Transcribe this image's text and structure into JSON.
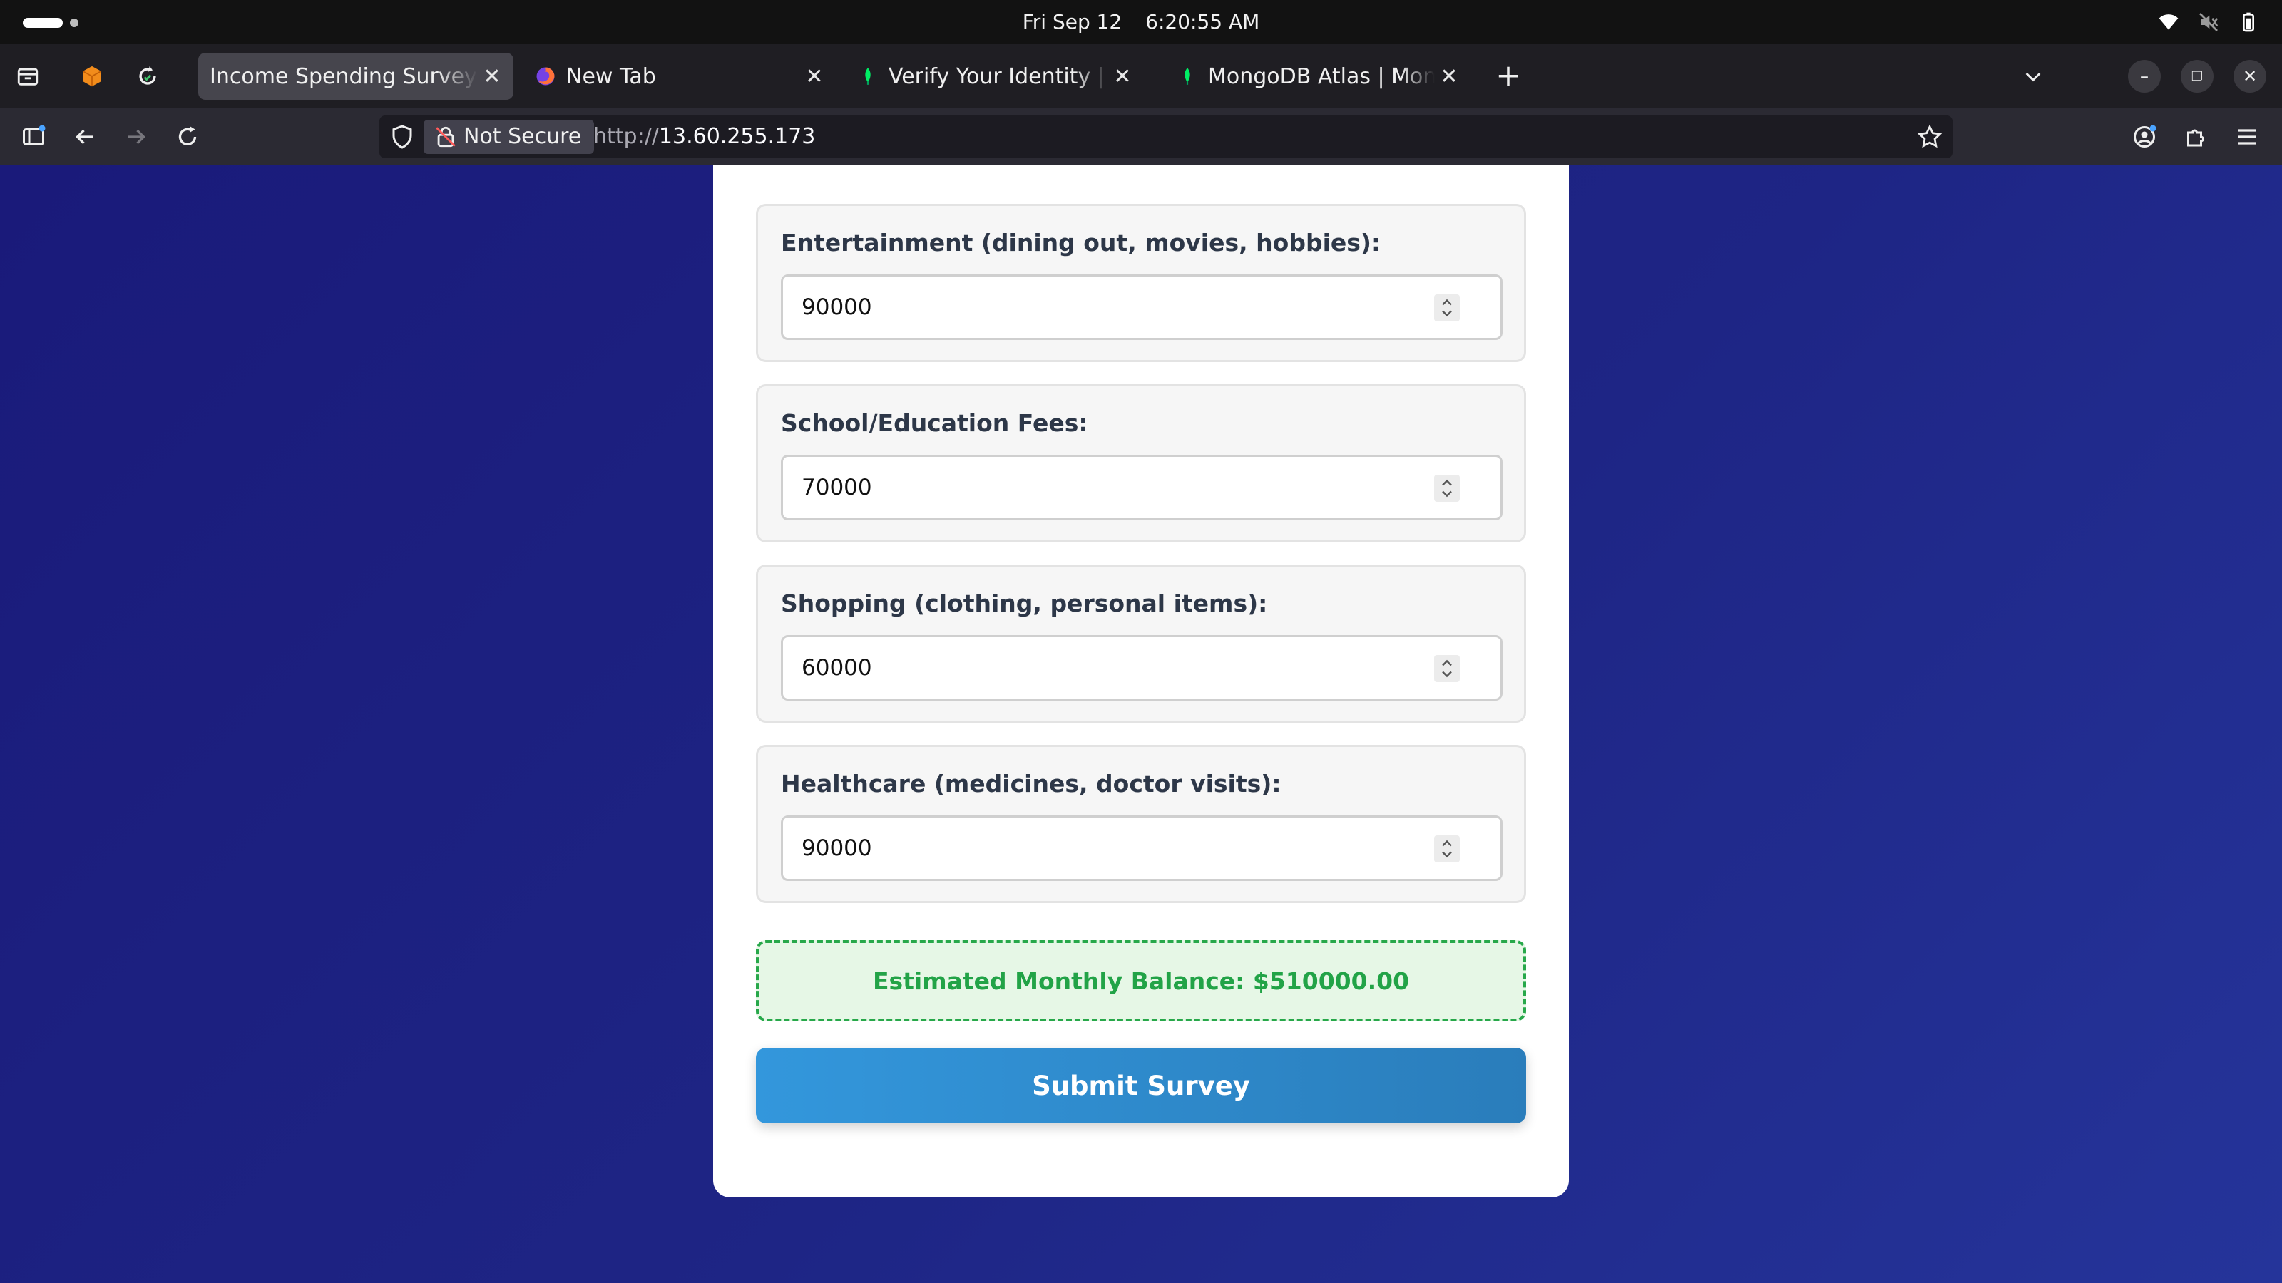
{
  "os": {
    "date": "Fri Sep 12",
    "time": "6:20:55 AM",
    "tray_icons": [
      "wifi-icon",
      "volume-muted-icon",
      "battery-icon"
    ]
  },
  "browser": {
    "tabs": [
      {
        "title": "Income Spending Survey",
        "active": true,
        "favicon": "none"
      },
      {
        "title": "New Tab",
        "active": false,
        "favicon": "firefox-icon"
      },
      {
        "title": "Verify Your Identity | Mon",
        "active": false,
        "favicon": "mongodb-leaf-icon"
      },
      {
        "title": "MongoDB Atlas | MongoD",
        "active": false,
        "favicon": "mongodb-leaf-icon"
      }
    ],
    "security_label": "Not Secure",
    "url_scheme": "http://",
    "url_host": "13.60.255.173"
  },
  "form": {
    "fields": [
      {
        "label": "Entertainment (dining out, movies, hobbies):",
        "value": "90000"
      },
      {
        "label": "School/Education Fees:",
        "value": "70000"
      },
      {
        "label": "Shopping (clothing, personal items):",
        "value": "60000"
      },
      {
        "label": "Healthcare (medicines, doctor visits):",
        "value": "90000"
      }
    ],
    "balance_text": "Estimated Monthly Balance: $510000.00",
    "submit_label": "Submit Survey"
  },
  "colors": {
    "background": "#1c1f7e",
    "balance_green": "#22a347",
    "submit_blue": "#3397dc"
  }
}
